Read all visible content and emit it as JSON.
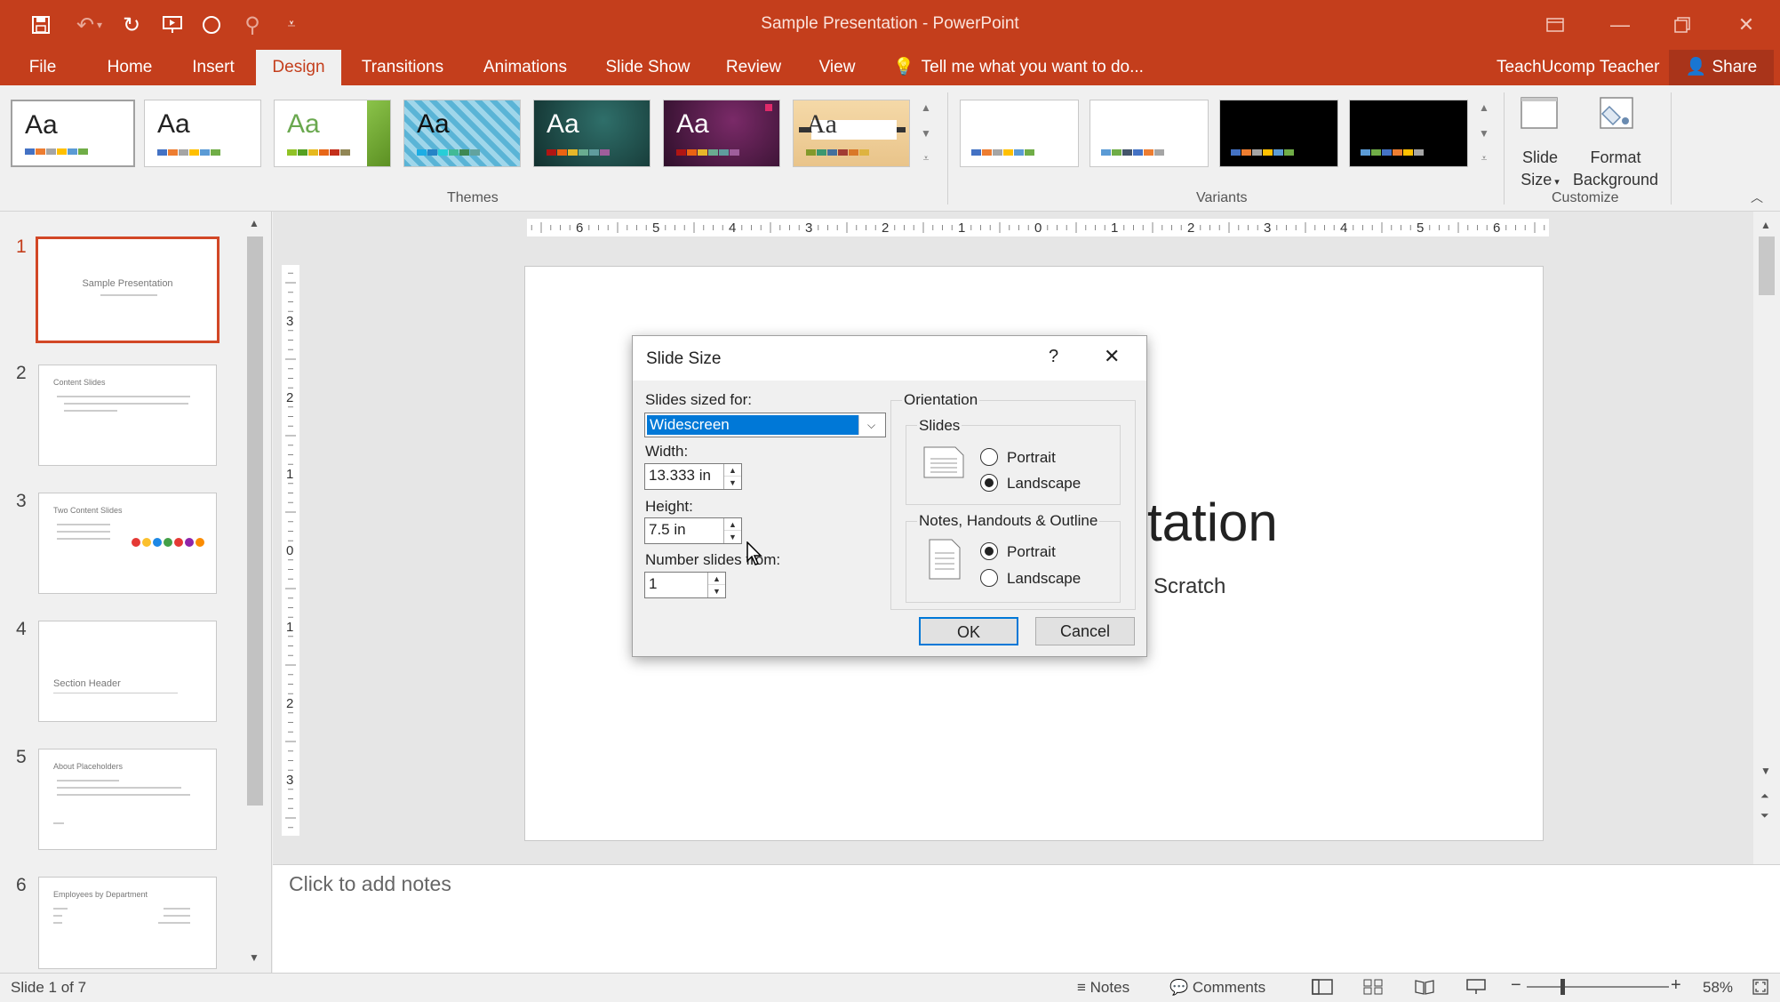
{
  "app": {
    "title": "Sample Presentation - PowerPoint"
  },
  "tabs": [
    {
      "label": "File"
    },
    {
      "label": "Home"
    },
    {
      "label": "Insert"
    },
    {
      "label": "Design"
    },
    {
      "label": "Transitions"
    },
    {
      "label": "Animations"
    },
    {
      "label": "Slide Show"
    },
    {
      "label": "Review"
    },
    {
      "label": "View"
    }
  ],
  "tell_me": "Tell me what you want to do...",
  "user": "TeachUcomp Teacher",
  "share": "Share",
  "ribbon": {
    "themes_label": "Themes",
    "theme_sample": "Aa",
    "variants_label": "Variants",
    "customize_label": "Customize",
    "slide_size_line1": "Slide",
    "slide_size_line2": "Size",
    "format_bg_line1": "Format",
    "format_bg_line2": "Background"
  },
  "colors": {
    "accent": "#c43e1c",
    "selected_thumb_border": "#d24726",
    "default_button_border": "#0078d7"
  },
  "slides": [
    {
      "num": "1",
      "title": "Sample Presentation"
    },
    {
      "num": "2",
      "title": "Content Slides"
    },
    {
      "num": "3",
      "title": "Two Content Slides"
    },
    {
      "num": "4",
      "title": "Section Header"
    },
    {
      "num": "5",
      "title": "About Placeholders"
    },
    {
      "num": "6",
      "title": "Employees by Department"
    }
  ],
  "slide_content": {
    "title_fragment": "tation",
    "subtitle_fragment": "Scratch"
  },
  "notes_placeholder": "Click to add notes",
  "status": {
    "slide_of": "Slide 1 of 7",
    "notes": "Notes",
    "comments": "Comments",
    "zoom": "58%"
  },
  "dialog": {
    "title": "Slide Size",
    "help": "?",
    "sized_for_label": "Slides sized for:",
    "sized_for_value": "Widescreen",
    "width_label": "Width:",
    "width_value": "13.333 in",
    "height_label": "Height:",
    "height_value": "7.5 in",
    "number_from_label": "Number slides from:",
    "number_from_value": "1",
    "orientation_label": "Orientation",
    "slides_group_label": "Slides",
    "notes_group_label": "Notes, Handouts & Outline",
    "portrait": "Portrait",
    "landscape": "Landscape",
    "slides_orientation": "Landscape",
    "notes_orientation": "Portrait",
    "ok": "OK",
    "cancel": "Cancel"
  }
}
